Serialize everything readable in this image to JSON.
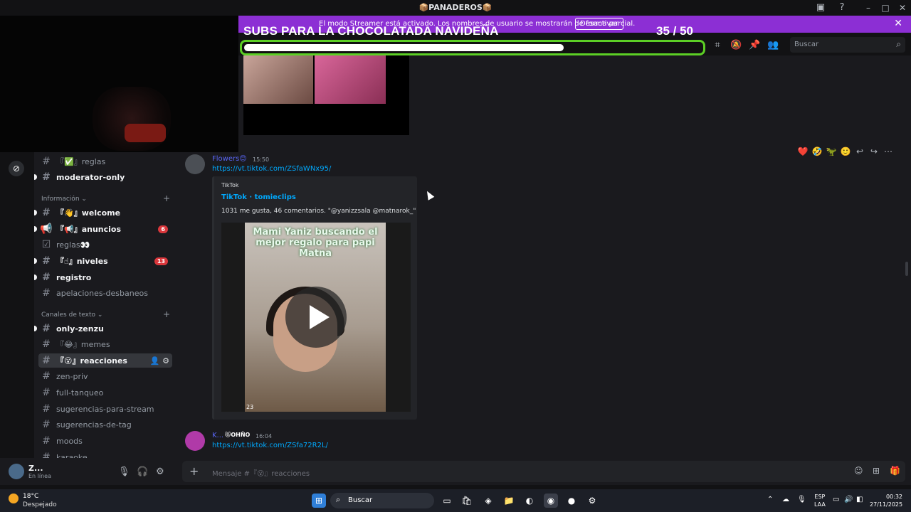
{
  "window": {
    "title": "📦PANADEROS📦",
    "controls": [
      "–",
      "□",
      "✕"
    ]
  },
  "streamer_bar": {
    "message": "El modo Streamer está activado. Los nombres de usuario se mostrarán de forma parcial.",
    "button": "Desactivar"
  },
  "overlay_goal": {
    "title": "SUBS PARA LA CHOCOLATADA NAVIDEÑA",
    "count": "35  / 50",
    "current": 35,
    "target": 50,
    "fill_color": "#ffffff",
    "border_color": "#5ccf25"
  },
  "header": {
    "search_placeholder": "Buscar",
    "toolbar_icons": [
      "threads-icon",
      "mute-icon",
      "pin-icon",
      "members-icon"
    ]
  },
  "sidebar": {
    "channels_top": [
      {
        "label": "『✅』reglas",
        "unread": false
      },
      {
        "label": "moderator-only",
        "unread": true
      }
    ],
    "category_info": "Información",
    "channels_info": [
      {
        "label": "『👋』welcome",
        "unread": true
      },
      {
        "label": "『📢』anuncios",
        "unread": true,
        "badge": "6"
      },
      {
        "label": "reglas👀",
        "unread": false
      },
      {
        "label": "『☝』niveles",
        "unread": true,
        "badge": "13"
      },
      {
        "label": "registro",
        "unread": true
      },
      {
        "label": "apelaciones-desbaneos",
        "unread": false
      }
    ],
    "category_text": "Canales de texto",
    "channels_text": [
      {
        "label": "only-zenzu",
        "unread": true
      },
      {
        "label": "『😂』memes",
        "unread": false
      },
      {
        "label": "『😮』reacciones",
        "unread": false,
        "active": true
      },
      {
        "label": "zen-priv",
        "unread": false
      },
      {
        "label": "full-tanqueo",
        "unread": false
      },
      {
        "label": "sugerencias-para-stream",
        "unread": false
      },
      {
        "label": "sugerencias-de-tag",
        "unread": false
      },
      {
        "label": "moods",
        "unread": false
      },
      {
        "label": "karaoke",
        "unread": false
      }
    ]
  },
  "user": {
    "name": "Z...",
    "status": "En línea"
  },
  "messages": [
    {
      "author": "Flowers😊",
      "time": "15:50",
      "link": "https://vt.tiktok.com/ZSfaWNx95/",
      "embed": {
        "provider": "TikTok",
        "title": "TikTok · tomieclips",
        "description": "1031 me gusta, 46 comentarios. \"@yanizzsala @matnarok_\"",
        "video_caption": "Mami Yaniz buscando el mejor regalo para papi Matna",
        "video_tag": "23"
      }
    },
    {
      "author": "K...",
      "role_tag": "😻OHÑO",
      "time": "16:04",
      "link": "https://vt.tiktok.com/ZSfa72R2L/"
    }
  ],
  "reactions_bar": [
    "❤️",
    "🤣",
    "🦖",
    "🙂",
    "↩",
    "↪",
    "⋯"
  ],
  "composer": {
    "placeholder": "Mensaje #『😮』reacciones"
  },
  "taskbar": {
    "temperature": "18°C",
    "condition": "Despejado",
    "search": "Buscar",
    "lang_top": "ESP",
    "lang_bottom": "LAA",
    "time": "00:32",
    "date": "27/11/2025"
  }
}
